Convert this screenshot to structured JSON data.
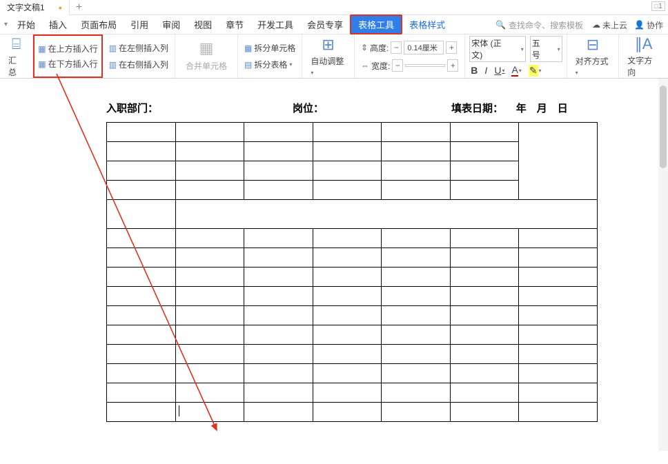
{
  "titlebar": {
    "tab_title": "文字文稿1",
    "tab_dirty": "•",
    "add_tab": "+",
    "page_corner": "1"
  },
  "menu": {
    "caret": "▾",
    "items": [
      "开始",
      "插入",
      "页面布局",
      "引用",
      "审阅",
      "视图",
      "章节",
      "开发工具",
      "会员专享"
    ],
    "active": "表格工具",
    "link": "表格样式",
    "search_placeholder": "查找命令、搜索模板",
    "cloud": "未上云",
    "collab": "协作"
  },
  "ribbon": {
    "summary": "汇总",
    "insert_row_above": "在上方插入行",
    "insert_row_below": "在下方插入行",
    "insert_col_left": "在左侧插入列",
    "insert_col_right": "在右侧插入列",
    "merge_cells": "合并单元格",
    "split_cells": "拆分单元格",
    "split_table": "拆分表格",
    "autofit": "自动调整",
    "height_label": "高度:",
    "height_value": "0.14厘米",
    "width_label": "宽度:",
    "width_value": "",
    "font_name": "宋体 (正文)",
    "font_size": "五号",
    "align": "对齐方式",
    "text_dir": "文字方向"
  },
  "doc": {
    "label1": "入职部门：",
    "label2": "岗位：",
    "label3_a": "填表日期：",
    "label3_b": "年",
    "label3_c": "月",
    "label3_d": "日"
  }
}
